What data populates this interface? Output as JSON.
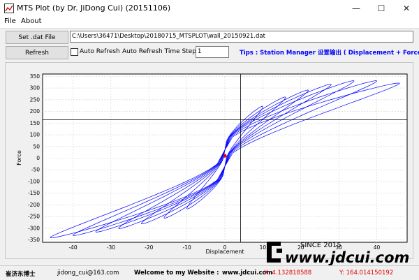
{
  "window": {
    "title": "MTS Plot (by Dr. JiDong Cui) (20151106)"
  },
  "menu": [
    "File",
    "About"
  ],
  "controls": {
    "set_file_label": "Set .dat File",
    "file_path": "C:\\Users\\36471\\Desktop\\20180715_MTSPLOT\\wall_20150921.dat",
    "refresh_label": "Refresh",
    "auto_refresh_label": "Auto Refresh",
    "auto_refresh_checked": false,
    "time_step_label": "Auto Refresh Time Step (s)",
    "time_step_value": "1",
    "tips": "Tips : Station Manager 设置输出 ( Displacement + Force )"
  },
  "chart_data": {
    "type": "line",
    "xlabel": "Displacement",
    "ylabel": "Force",
    "xlim": [
      -48,
      48
    ],
    "ylim": [
      -360,
      360
    ],
    "x_ticks": [
      -40,
      -30,
      -20,
      -10,
      0,
      10,
      20,
      30,
      40
    ],
    "y_ticks": [
      -350,
      -300,
      -250,
      -200,
      -150,
      -100,
      -50,
      0,
      50,
      100,
      150,
      200,
      250,
      300,
      350
    ],
    "grid": true,
    "line_color": "#0000ff",
    "loops": [
      {
        "amp": 10,
        "fmax": 220,
        "fmin": -215
      },
      {
        "amp": 16,
        "fmax": 260,
        "fmin": -255
      },
      {
        "amp": 22,
        "fmax": 290,
        "fmin": -280
      },
      {
        "amp": 28,
        "fmax": 315,
        "fmin": -300
      },
      {
        "amp": 34,
        "fmax": 330,
        "fmin": -315
      },
      {
        "amp": 40,
        "fmax": 330,
        "fmin": -330
      },
      {
        "amp": 46,
        "fmax": 320,
        "fmin": -340
      }
    ],
    "marker": {
      "x": 0,
      "y": 10,
      "color": "#e00000"
    },
    "cursor": {
      "x": 4.132818588,
      "y": 164.014150192
    }
  },
  "status": {
    "author": "崔济东博士",
    "email": "jidong_cui@163.com",
    "welcome": "Welcome to my Website :",
    "website": "www.jdcui.com",
    "x_readout": "X: 4.132818588",
    "y_readout": "Y: 164.014150192"
  },
  "watermark": {
    "since": "SINCE 2015",
    "site": "www.jdcui.com"
  }
}
